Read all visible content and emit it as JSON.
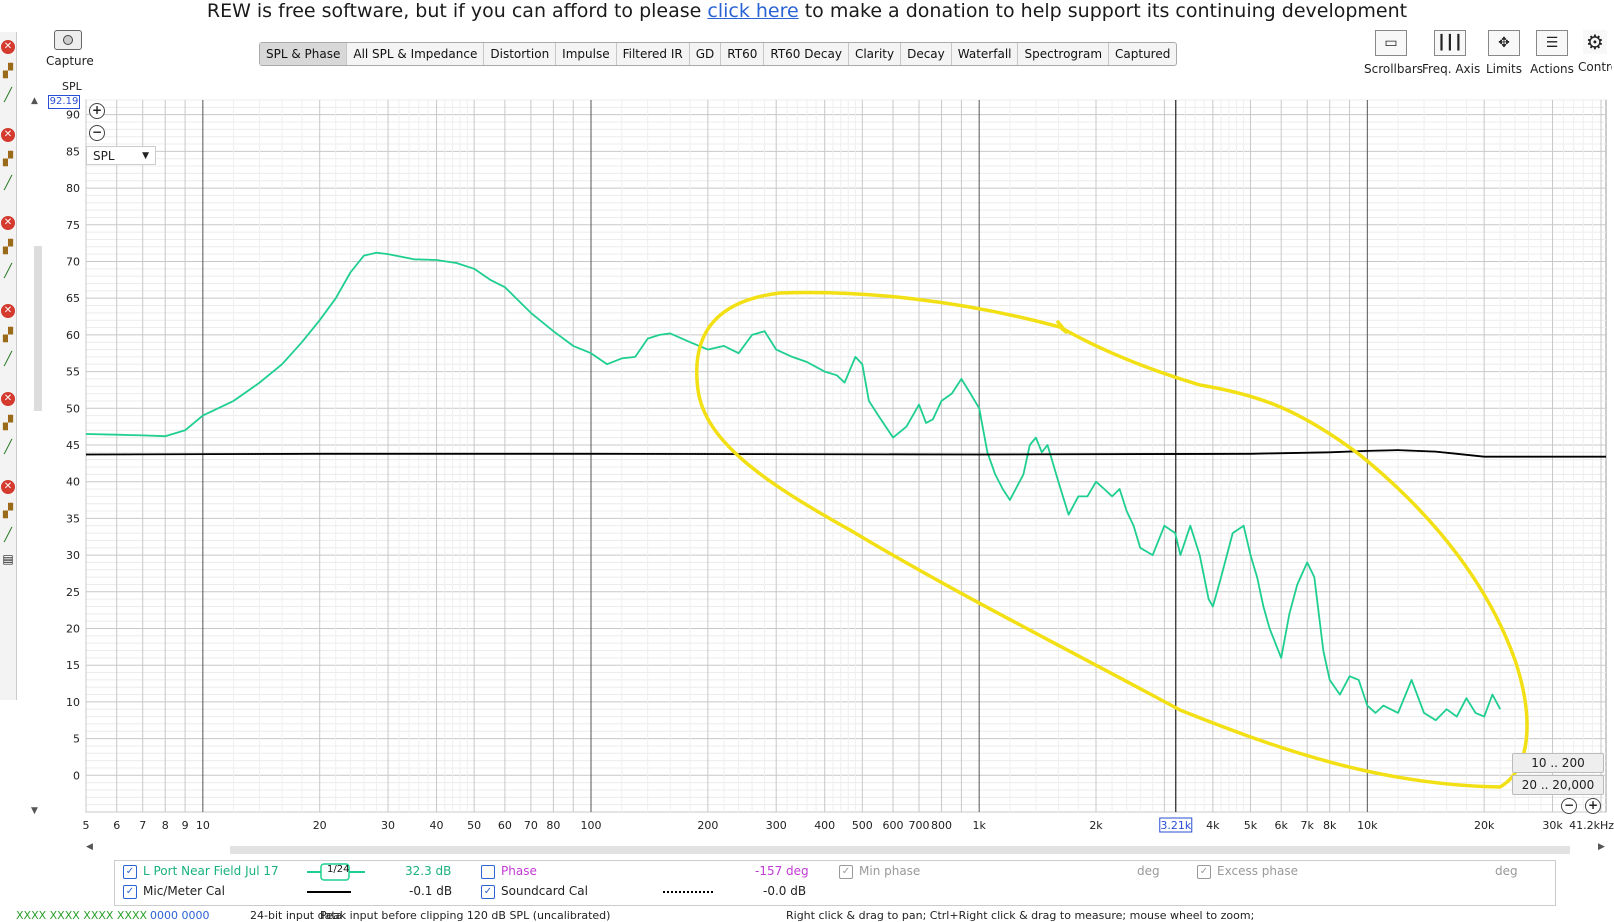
{
  "banner": {
    "pre": "REW is free software, but if you can afford to please ",
    "link": "click here",
    "post": " to make a donation to help support its continuing development"
  },
  "capture": {
    "label": "Capture"
  },
  "tabs": [
    {
      "label": "SPL & Phase",
      "active": true
    },
    {
      "label": "All SPL & Impedance"
    },
    {
      "label": "Distortion"
    },
    {
      "label": "Impulse"
    },
    {
      "label": "Filtered IR"
    },
    {
      "label": "GD"
    },
    {
      "label": "RT60"
    },
    {
      "label": "RT60 Decay"
    },
    {
      "label": "Clarity"
    },
    {
      "label": "Decay"
    },
    {
      "label": "Waterfall"
    },
    {
      "label": "Spectrogram"
    },
    {
      "label": "Captured"
    }
  ],
  "toolbar_right": [
    {
      "label": "Scrollbars",
      "icon": "scrollbars-icon"
    },
    {
      "label": "Freq. Axis",
      "icon": "freq-axis-icon"
    },
    {
      "label": "Limits",
      "icon": "limits-arrows-icon"
    },
    {
      "label": "Actions",
      "icon": "actions-icon"
    },
    {
      "label": "Contro",
      "icon": "gear-icon"
    }
  ],
  "axis": {
    "y_title": "SPL",
    "y_cursor_value": "92.19",
    "y_ticks": [
      "90",
      "85",
      "80",
      "75",
      "70",
      "65",
      "60",
      "55",
      "50",
      "45",
      "40",
      "35",
      "30",
      "25",
      "20",
      "15",
      "10",
      "5",
      "0"
    ],
    "x_labels": [
      "5",
      "6",
      "7",
      "8",
      "9",
      "10",
      "20",
      "30",
      "40",
      "50",
      "60",
      "70",
      "80",
      "100",
      "200",
      "300",
      "400",
      "500",
      "600",
      "700",
      "800",
      "1k",
      "2k",
      "3.21k",
      "4k",
      "5k",
      "6k",
      "7k",
      "8k",
      "10k",
      "20k",
      "30k",
      "41.2kHz"
    ],
    "x_cursor_label": "3.21k"
  },
  "spl_select": {
    "value": "SPL"
  },
  "range_buttons": [
    "10 .. 200",
    "20 .. 20,000"
  ],
  "chart_data": {
    "type": "line",
    "xscale": "log",
    "xlim": [
      5,
      41200
    ],
    "ylim": [
      -5,
      92
    ],
    "series": [
      {
        "name": "L Port Near Field Jul 17",
        "color": "#1fcf8f",
        "points": [
          [
            5,
            46.5
          ],
          [
            6,
            46.4
          ],
          [
            7,
            46.3
          ],
          [
            8,
            46.2
          ],
          [
            9,
            47
          ],
          [
            10,
            49
          ],
          [
            12,
            51
          ],
          [
            14,
            53.5
          ],
          [
            16,
            56
          ],
          [
            18,
            59
          ],
          [
            20,
            62
          ],
          [
            22,
            65
          ],
          [
            24,
            68.5
          ],
          [
            26,
            70.8
          ],
          [
            28,
            71.2
          ],
          [
            30,
            71
          ],
          [
            35,
            70.3
          ],
          [
            40,
            70.2
          ],
          [
            45,
            69.8
          ],
          [
            50,
            69
          ],
          [
            55,
            67.5
          ],
          [
            60,
            66.5
          ],
          [
            70,
            63
          ],
          [
            80,
            60.5
          ],
          [
            90,
            58.5
          ],
          [
            100,
            57.5
          ],
          [
            110,
            56
          ],
          [
            120,
            56.8
          ],
          [
            130,
            57
          ],
          [
            140,
            59.5
          ],
          [
            150,
            60
          ],
          [
            160,
            60.2
          ],
          [
            180,
            59
          ],
          [
            200,
            58
          ],
          [
            220,
            58.5
          ],
          [
            240,
            57.5
          ],
          [
            260,
            60
          ],
          [
            280,
            60.5
          ],
          [
            300,
            58
          ],
          [
            330,
            57
          ],
          [
            360,
            56.3
          ],
          [
            400,
            55
          ],
          [
            430,
            54.5
          ],
          [
            450,
            53.5
          ],
          [
            480,
            57
          ],
          [
            500,
            56
          ],
          [
            520,
            51
          ],
          [
            550,
            49
          ],
          [
            600,
            46
          ],
          [
            650,
            47.5
          ],
          [
            700,
            50.5
          ],
          [
            730,
            48
          ],
          [
            760,
            48.5
          ],
          [
            800,
            51
          ],
          [
            850,
            52
          ],
          [
            900,
            54
          ],
          [
            950,
            52
          ],
          [
            1000,
            50
          ],
          [
            1050,
            44
          ],
          [
            1100,
            41
          ],
          [
            1150,
            39
          ],
          [
            1200,
            37.5
          ],
          [
            1300,
            41
          ],
          [
            1350,
            45
          ],
          [
            1400,
            46
          ],
          [
            1450,
            44
          ],
          [
            1500,
            45
          ],
          [
            1600,
            40
          ],
          [
            1700,
            35.5
          ],
          [
            1800,
            38
          ],
          [
            1900,
            38
          ],
          [
            2000,
            40
          ],
          [
            2100,
            39
          ],
          [
            2200,
            38
          ],
          [
            2300,
            39
          ],
          [
            2400,
            36
          ],
          [
            2500,
            34
          ],
          [
            2600,
            31
          ],
          [
            2800,
            30
          ],
          [
            3000,
            34
          ],
          [
            3200,
            33
          ],
          [
            3300,
            30
          ],
          [
            3500,
            34
          ],
          [
            3700,
            30
          ],
          [
            3900,
            24
          ],
          [
            4000,
            23
          ],
          [
            4200,
            27
          ],
          [
            4500,
            33
          ],
          [
            4800,
            34
          ],
          [
            5000,
            30
          ],
          [
            5200,
            27
          ],
          [
            5400,
            23
          ],
          [
            5600,
            20
          ],
          [
            6000,
            16
          ],
          [
            6300,
            22
          ],
          [
            6600,
            26
          ],
          [
            7000,
            29
          ],
          [
            7300,
            27
          ],
          [
            7700,
            17
          ],
          [
            8000,
            13
          ],
          [
            8500,
            11
          ],
          [
            9000,
            13.5
          ],
          [
            9500,
            13
          ],
          [
            10000,
            9.5
          ],
          [
            10500,
            8.5
          ],
          [
            11000,
            9.5
          ],
          [
            12000,
            8.5
          ],
          [
            13000,
            13
          ],
          [
            14000,
            8.5
          ],
          [
            15000,
            7.5
          ],
          [
            16000,
            9
          ],
          [
            17000,
            8
          ],
          [
            18000,
            10.5
          ],
          [
            19000,
            8.5
          ],
          [
            20000,
            8
          ],
          [
            21000,
            11
          ],
          [
            22000,
            9
          ]
        ]
      },
      {
        "name": "Mic/Meter Cal",
        "color": "#000000",
        "points": [
          [
            5,
            43.7
          ],
          [
            20,
            43.8
          ],
          [
            100,
            43.8
          ],
          [
            1000,
            43.7
          ],
          [
            5000,
            43.8
          ],
          [
            8000,
            44
          ],
          [
            10000,
            44.2
          ],
          [
            12000,
            44.3
          ],
          [
            15000,
            44.1
          ],
          [
            17000,
            43.8
          ],
          [
            20000,
            43.4
          ],
          [
            41200,
            43.4
          ]
        ]
      }
    ]
  },
  "legend": {
    "row1": {
      "name": "L Port Near Field Jul 17",
      "smoothing": "1/24",
      "value": "32.3 dB",
      "phase_label": "Phase",
      "phase_value": "-157 deg",
      "min_phase": "Min phase",
      "deg1": "deg",
      "excess_phase": "Excess phase",
      "deg2": "deg"
    },
    "row2": {
      "name": "Mic/Meter Cal",
      "value": "-0.1 dB",
      "soundcard": "Soundcard Cal",
      "soundcard_value": "-0.0 dB"
    }
  },
  "status": {
    "meters": "XXXX XXXX   XXXX XXXX",
    "zeros": "0000 0000",
    "input": "24-bit input data",
    "peak": "Peak input before clipping 120 dB SPL (uncalibrated)",
    "help": "Right click & drag to pan; Ctrl+Right click & drag to measure; mouse wheel to zoom;"
  }
}
